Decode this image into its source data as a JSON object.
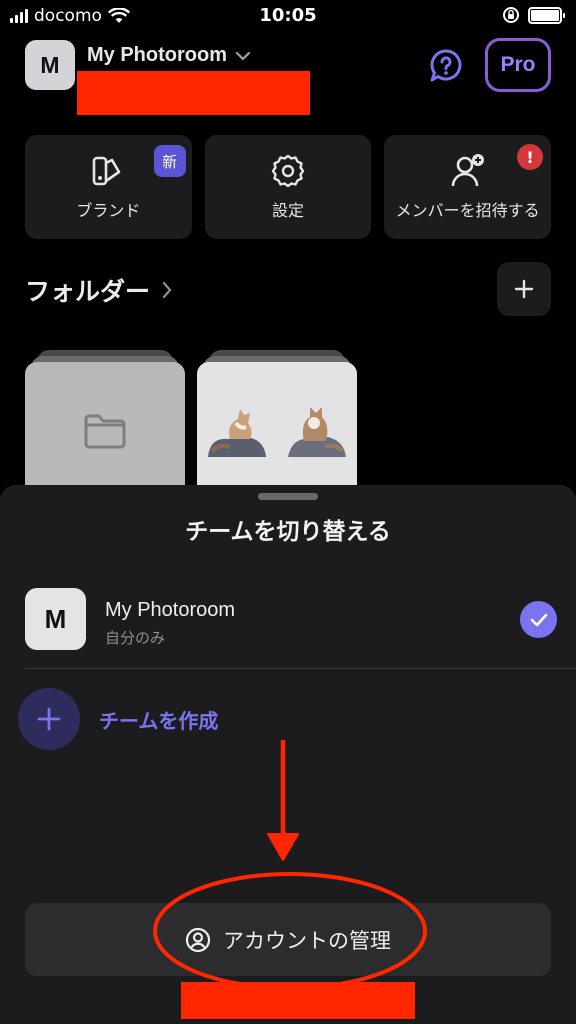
{
  "status_bar": {
    "carrier": "docomo",
    "time": "10:05"
  },
  "header": {
    "avatar_letter": "M",
    "workspace_name": "My Photoroom",
    "pro_label": "Pro"
  },
  "tiles": [
    {
      "label": "ブランド",
      "badge": "新"
    },
    {
      "label": "設定"
    },
    {
      "label": "メンバーを招待する",
      "badge": "!"
    }
  ],
  "folders": {
    "title": "フォルダー"
  },
  "sheet": {
    "title": "チームを切り替える",
    "team": {
      "avatar_letter": "M",
      "name": "My Photoroom",
      "subtitle": "自分のみ",
      "selected": true
    },
    "create_label": "チームを作成",
    "account_button_label": "アカウントの管理"
  },
  "colors": {
    "accent": "#7b74f0",
    "pro_border": "#8a5cd8",
    "annotation_red": "#ff2600",
    "alert": "#d6373a"
  }
}
